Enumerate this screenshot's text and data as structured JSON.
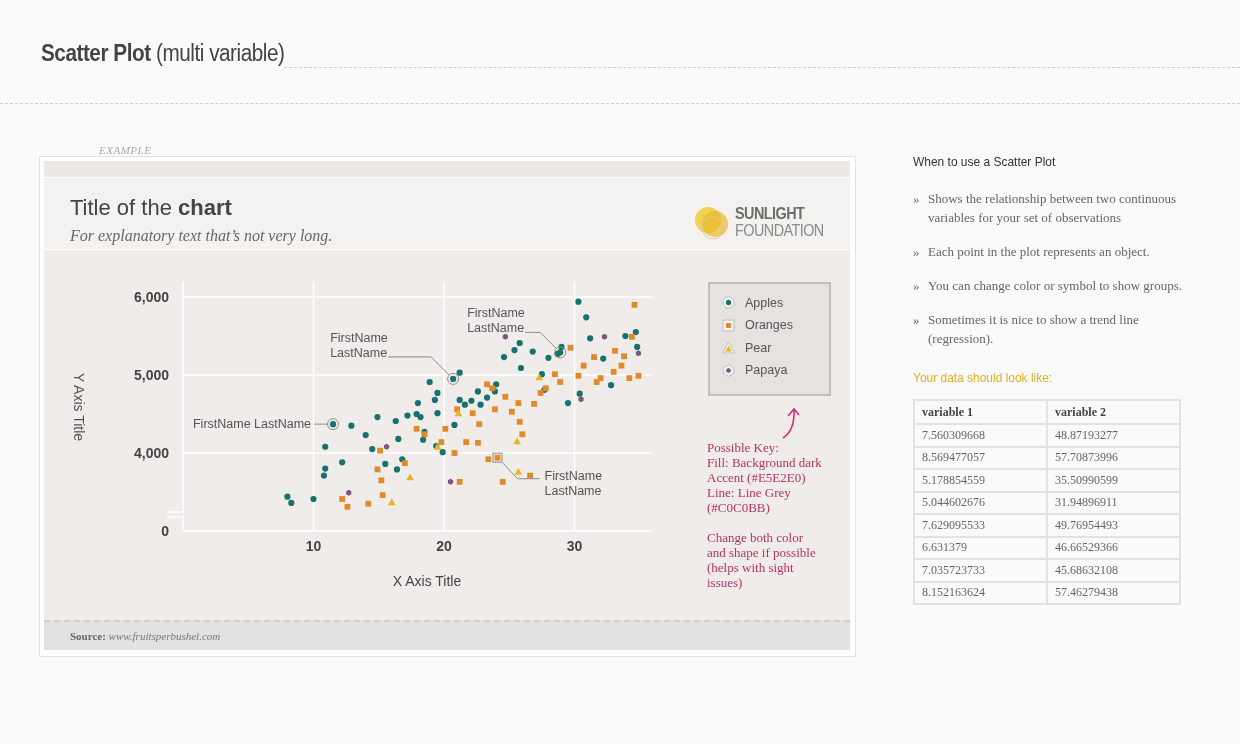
{
  "page_header": {
    "title": "**Scatter Plot** (multi variable)"
  },
  "example_label": "EXAMPLE",
  "chart_card": {
    "subtitle": "For explanatory text that’s not very long.",
    "logo": {
      "lines": [
        "SUNLIGHT",
        "FOUNDATION"
      ]
    },
    "axis_break_label": "0",
    "marker_shapes": [
      {
        "kind": "dot"
      },
      {
        "kind": "square"
      },
      {
        "kind": "triangle"
      },
      {
        "kind": "hexagon"
      }
    ],
    "chart_data": {
      "type": "scatter",
      "grid": true,
      "title": "Title of the **chart**",
      "xlabel": "X Axis Title",
      "ylabel": "Y Axis Title",
      "xlim": [
        0,
        36
      ],
      "ylim": [
        3000,
        6200
      ],
      "xticks": [
        10,
        20,
        30
      ],
      "yticks": [
        {
          "value": 4000,
          "label": "4,000"
        },
        {
          "value": 5000,
          "label": "5,000"
        },
        {
          "value": 6000,
          "label": "6,000"
        }
      ],
      "series": [
        {
          "name": "Apples",
          "color": "#17716f",
          "x": [
            8.0,
            8.3,
            10.0,
            10.9,
            10.8,
            10.9,
            12.2,
            11.5,
            12.9,
            14.0,
            14.5,
            14.9,
            15.5,
            16.3,
            16.4,
            16.8,
            16.5,
            17.2,
            17.9,
            18.0,
            18.4,
            18.2,
            18.5,
            18.9,
            19.5,
            19.5,
            19.4,
            19.3,
            20.7,
            21.2,
            19.9,
            20.8,
            21.2,
            21.6,
            22.1,
            22.6,
            22.8,
            23.3,
            23.9,
            24.0,
            24.6,
            25.4,
            25.8,
            26.8,
            27.7,
            28.0,
            28.7,
            28.9,
            29.0,
            29.5,
            30.3,
            30.9,
            30.4,
            31.2,
            32.2,
            32.8,
            33.9,
            34.7,
            34.8,
            25.9,
            27.5
          ],
          "values": [
            3440,
            3360,
            3410,
            3800,
            3710,
            4080,
            3880,
            4370,
            4350,
            4230,
            4050,
            4460,
            3860,
            4410,
            3790,
            3920,
            4180,
            4480,
            4500,
            4640,
            4170,
            4460,
            4270,
            4910,
            4510,
            4770,
            4090,
            4680,
            4950,
            5030,
            4010,
            4360,
            4680,
            4620,
            4670,
            4790,
            4620,
            4710,
            4790,
            4880,
            5230,
            5320,
            5410,
            5300,
            4810,
            5220,
            5270,
            5290,
            5360,
            4640,
            5940,
            5740,
            4760,
            5470,
            5210,
            4870,
            5500,
            5550,
            5360,
            5090,
            5010
          ]
        },
        {
          "name": "Oranges",
          "color": "#e08a2c",
          "x": [
            12.2,
            12.6,
            14.2,
            15.2,
            14.9,
            15.1,
            15.3,
            17.0,
            18.5,
            17.9,
            20.1,
            20.8,
            21.7,
            22.2,
            22.6,
            23.3,
            23.7,
            23.9,
            22.7,
            23.4,
            25.2,
            24.5,
            25.7,
            26.0,
            26.6,
            26.9,
            27.4,
            27.8,
            28.5,
            28.9,
            29.7,
            30.3,
            30.7,
            31.5,
            33.1,
            33.6,
            34.4,
            34.6,
            33.8,
            34.2,
            34.9,
            32.0,
            33.0,
            31.7,
            21.0,
            19.8,
            21.2,
            24.7,
            25.8,
            24.1
          ],
          "values": [
            3410,
            3310,
            3350,
            3650,
            3790,
            4030,
            3460,
            3870,
            4240,
            4310,
            4310,
            4000,
            4140,
            4510,
            4130,
            4880,
            4830,
            4560,
            4370,
            3920,
            4530,
            3630,
            4640,
            4240,
            3710,
            4630,
            4770,
            4830,
            5010,
            4910,
            5350,
            4990,
            5120,
            5230,
            5310,
            5120,
            5490,
            5900,
            5240,
            4960,
            4990,
            4960,
            5040,
            4910,
            4560,
            4140,
            3630,
            4720,
            4400,
            3940
          ]
        },
        {
          "name": "Pear",
          "color": "#e6b61e",
          "x": [
            16.0,
            17.4,
            19.5,
            21.1,
            25.6,
            27.3,
            25.7
          ],
          "values": [
            3370,
            3690,
            4080,
            4510,
            4150,
            4970,
            3760
          ]
        },
        {
          "name": "Papaya",
          "color": "#7a5680",
          "x": [
            12.7,
            15.6,
            20.5,
            24.7,
            32.3,
            34.9,
            30.5
          ],
          "values": [
            3490,
            4080,
            3630,
            5490,
            5490,
            5280,
            4690
          ]
        }
      ],
      "annotations": [
        {
          "text": "FirstName LastName",
          "x": 11.5,
          "y": 4370
        },
        {
          "text": "FirstName\nLastName",
          "x": 20.7,
          "y": 4950
        },
        {
          "text": "FirstName\nLastName",
          "x": 28.9,
          "y": 5290
        },
        {
          "text": "FirstName\nLastName",
          "x": 24.1,
          "y": 3940
        }
      ]
    },
    "notes": [
      "Possible Key:\nFill: Background dark\nAccent (#E5E2E0)\nLine: Line Grey\n(#C0C0BB)",
      "Change both color\nand shape if possible\n(helps with sight\nissues)"
    ],
    "source": "**Source:** *www.fruitsperbushel.com*"
  },
  "sidebar": {
    "heading": "When to use a Scatter Plot",
    "bullets": [
      {
        "marker": "»",
        "text": "Shows the relationship between two continuous variables for your set of observations"
      },
      {
        "marker": "»",
        "text": "Each point in the plot represents an object."
      },
      {
        "marker": "»",
        "text": "You can change color or symbol to show groups."
      },
      {
        "marker": "»",
        "text": "Sometimes it is nice to show a trend line (regression)."
      }
    ],
    "data_heading": "Your data should look like:",
    "table": {
      "columns": [
        "variable 1",
        "variable 2"
      ],
      "rows": [
        [
          "7.560309668",
          "48.87193277"
        ],
        [
          "8.569477057",
          "57.70873996"
        ],
        [
          "5.178854559",
          "35.50990599"
        ],
        [
          "5.044602676",
          "31.94896911"
        ],
        [
          "7.629095533",
          "49.76954493"
        ],
        [
          "6.631379",
          "46.66529366"
        ],
        [
          "7.035723733",
          "45.68632108"
        ],
        [
          "8.152163624",
          "57.46279438"
        ]
      ]
    }
  }
}
